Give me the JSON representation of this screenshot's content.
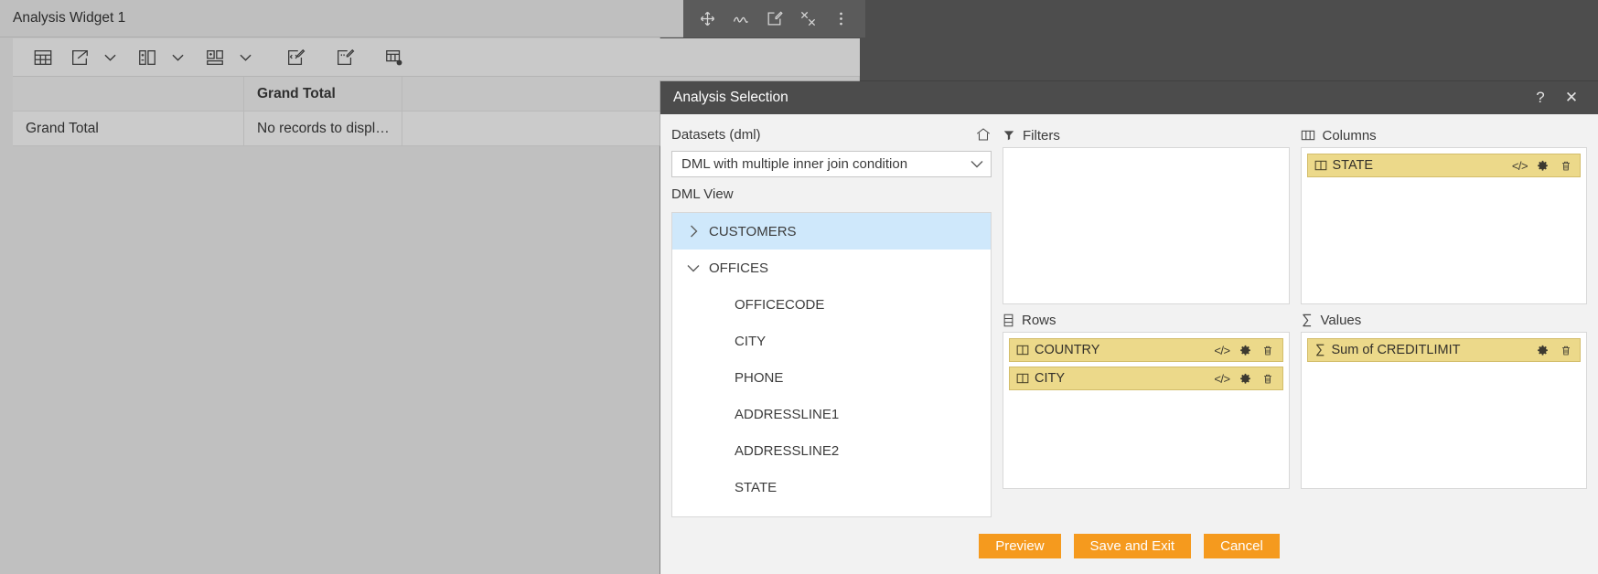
{
  "widget": {
    "title": "Analysis Widget 1",
    "header_actions": [
      {
        "name": "move-icon",
        "title": "Move"
      },
      {
        "name": "scribble-icon",
        "title": "Annotate"
      },
      {
        "name": "edit-icon",
        "title": "Edit"
      },
      {
        "name": "tools-icon",
        "title": "Tools"
      },
      {
        "name": "more-vertical-icon",
        "title": "More"
      }
    ],
    "toolbar": [
      {
        "name": "table-icon",
        "caret": false
      },
      {
        "name": "export-icon",
        "caret": true
      },
      {
        "name": "column-settings-icon",
        "caret": true
      },
      {
        "name": "layout-icon",
        "caret": true
      },
      {
        "name": "code-edit-icon",
        "caret": false
      },
      {
        "name": "note-edit-icon",
        "caret": false
      },
      {
        "name": "grid-settings-icon",
        "caret": false
      }
    ],
    "pivot": {
      "header": [
        "",
        "Grand Total",
        ""
      ],
      "rows": [
        [
          "Grand Total",
          "No records to displ…",
          ""
        ]
      ]
    }
  },
  "dialog": {
    "title": "Analysis Selection",
    "help_label": "?",
    "close_label": "✕",
    "datasets": {
      "label": "Datasets (dml)",
      "home_icon": "home-icon",
      "selected": "DML with multiple inner join condition",
      "caret_icon": "chevron-down-icon"
    },
    "tree": {
      "label": "DML View",
      "nodes": [
        {
          "label": "CUSTOMERS",
          "level": 0,
          "expanded": false,
          "selected": true
        },
        {
          "label": "OFFICES",
          "level": 0,
          "expanded": true,
          "selected": false
        },
        {
          "label": "OFFICECODE",
          "level": 1,
          "leaf": true
        },
        {
          "label": "CITY",
          "level": 1,
          "leaf": true
        },
        {
          "label": "PHONE",
          "level": 1,
          "leaf": true
        },
        {
          "label": "ADDRESSLINE1",
          "level": 1,
          "leaf": true
        },
        {
          "label": "ADDRESSLINE2",
          "level": 1,
          "leaf": true
        },
        {
          "label": "STATE",
          "level": 1,
          "leaf": true
        }
      ]
    },
    "zones": {
      "filters": {
        "title": "Filters",
        "icon": "filter-icon",
        "chips": []
      },
      "columns": {
        "title": "Columns",
        "icon": "columns-icon",
        "chips": [
          {
            "label": "STATE",
            "icon": "column-field-icon",
            "actions": [
              "code-icon",
              "gear-icon",
              "trash-icon"
            ]
          }
        ]
      },
      "rows": {
        "title": "Rows",
        "icon": "rows-icon",
        "chips": [
          {
            "label": "COUNTRY",
            "icon": "column-field-icon",
            "actions": [
              "code-icon",
              "gear-icon",
              "trash-icon"
            ]
          },
          {
            "label": "CITY",
            "icon": "column-field-icon",
            "actions": [
              "code-icon",
              "gear-icon",
              "trash-icon"
            ]
          }
        ]
      },
      "values": {
        "title": "Values",
        "icon": "sigma-icon",
        "chips": [
          {
            "label": "Sum of CREDITLIMIT",
            "icon": "sigma-icon",
            "actions": [
              "gear-icon",
              "trash-icon"
            ]
          }
        ]
      }
    },
    "buttons": [
      {
        "label": "Preview",
        "name": "preview-button"
      },
      {
        "label": "Save and Exit",
        "name": "save-and-exit-button"
      },
      {
        "label": "Cancel",
        "name": "cancel-button"
      }
    ]
  },
  "colors": {
    "accent_orange": "#f59a1e",
    "chip_yellow": "#ecd98a",
    "selection_blue": "#cfe8fb",
    "titlebar_dark": "#4c4c4c"
  }
}
